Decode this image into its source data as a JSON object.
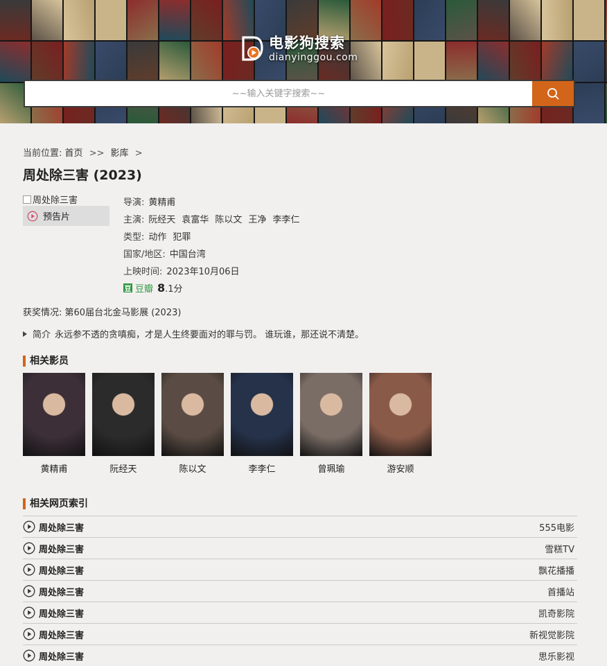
{
  "site": {
    "logo_text": "电影狗搜索",
    "logo_domain": "dianyinggou.com",
    "search_placeholder": "~~输入关键字搜索~~"
  },
  "breadcrumb": {
    "label": "当前位置:",
    "home": "首页",
    "sep1": ">>",
    "library": "影库",
    "sep2": ">"
  },
  "movie": {
    "title": "周处除三害 (2023)",
    "poster_alt": "周处除三害",
    "trailer_label": "预告片",
    "director": {
      "label": "导演:",
      "values": [
        "黄精甫"
      ]
    },
    "cast": {
      "label": "主演:",
      "values": [
        "阮经天",
        "袁富华",
        "陈以文",
        "王净",
        "李李仁"
      ]
    },
    "genre": {
      "label": "类型:",
      "values": [
        "动作",
        "犯罪"
      ]
    },
    "region": {
      "label": "国家/地区:",
      "values": [
        "中国台湾"
      ]
    },
    "release": {
      "label": "上映时间:",
      "value": "2023年10月06日"
    },
    "douban": {
      "badge": "豆",
      "name": "豆瓣",
      "score_major": "8",
      "score_minor": ".1分"
    },
    "awards": {
      "label": "获奖情况:",
      "value": "第60届台北金马影展 (2023)"
    },
    "intro": {
      "label": "简介",
      "text": "永远参不透的贪嗔痴，才是人生终要面对的罪与罚。 谁玩谁，那还说不清楚。"
    }
  },
  "related_people": {
    "heading": "相关影员",
    "people": [
      {
        "name": "黄精甫",
        "bg": "#3c2f38"
      },
      {
        "name": "阮经天",
        "bg": "#2b2b2b"
      },
      {
        "name": "陈以文",
        "bg": "#5a4c44"
      },
      {
        "name": "李李仁",
        "bg": "#25324a"
      },
      {
        "name": "曾珮瑜",
        "bg": "#7a6d66"
      },
      {
        "name": "游安顺",
        "bg": "#8a5a48"
      }
    ]
  },
  "related_links": {
    "heading": "相关网页索引",
    "items": [
      {
        "title": "周处除三害",
        "source": "555电影"
      },
      {
        "title": "周处除三害",
        "source": "雪糕TV"
      },
      {
        "title": "周处除三害",
        "source": "飘花播播"
      },
      {
        "title": "周处除三害",
        "source": "首播站"
      },
      {
        "title": "周处除三害",
        "source": "凯奇影院"
      },
      {
        "title": "周处除三害",
        "source": "新视觉影院"
      },
      {
        "title": "周处除三害",
        "source": "思乐影视"
      }
    ]
  },
  "colors": {
    "accent": "#d3651a",
    "douban": "#2e963d",
    "page_bg": "#f1f0ef"
  }
}
